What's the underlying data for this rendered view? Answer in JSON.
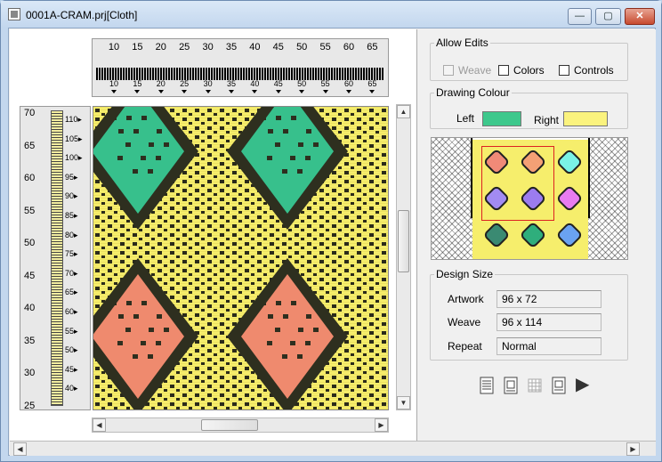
{
  "window": {
    "title": "0001A-CRAM.prj[Cloth]",
    "minimize_label": "—",
    "maximize_label": "▢",
    "close_label": "✕"
  },
  "ruler_top": {
    "top_numbers": [
      "10",
      "15",
      "20",
      "25",
      "30",
      "35",
      "40",
      "45",
      "50",
      "55",
      "60",
      "65"
    ],
    "bottom_numbers": [
      "10",
      "15",
      "20",
      "25",
      "30",
      "35",
      "40",
      "45",
      "50",
      "55",
      "60",
      "65"
    ]
  },
  "ruler_left": {
    "left_numbers": [
      "70",
      "65",
      "60",
      "55",
      "50",
      "45",
      "40",
      "35",
      "30",
      "25"
    ],
    "right_numbers": [
      "110",
      "105",
      "100",
      "95",
      "90",
      "85",
      "80",
      "75",
      "70",
      "65",
      "60",
      "55",
      "50",
      "45",
      "40"
    ]
  },
  "allow_edits": {
    "legend": "Allow Edits",
    "weave_label": "Weave",
    "colors_label": "Colors",
    "controls_label": "Controls"
  },
  "drawing_colour": {
    "legend": "Drawing Colour",
    "left_label": "Left",
    "right_label": "Right",
    "left_color": "#3ec88c",
    "right_color": "#fbf37e"
  },
  "palette": {
    "cells": [
      "#f08a78",
      "#f4a075",
      "#7af2e6",
      "#a28bf2",
      "#9c7cf0",
      "#e87cf0",
      "#3a8a72",
      "#2fae7c",
      "#6aa2f2"
    ]
  },
  "design_size": {
    "legend": "Design Size",
    "artwork_label": "Artwork",
    "artwork_value": "96 x 72",
    "weave_label": "Weave",
    "weave_value": "96 x 114",
    "repeat_label": "Repeat",
    "repeat_value": "Normal"
  },
  "toolbar": {
    "play_label": "▶"
  },
  "cloth_colors": {
    "background": "#f6ee6c",
    "diamond_top": "#37c08c",
    "diamond_bottom": "#ef8a6e",
    "outline": "#2e2f1f"
  }
}
